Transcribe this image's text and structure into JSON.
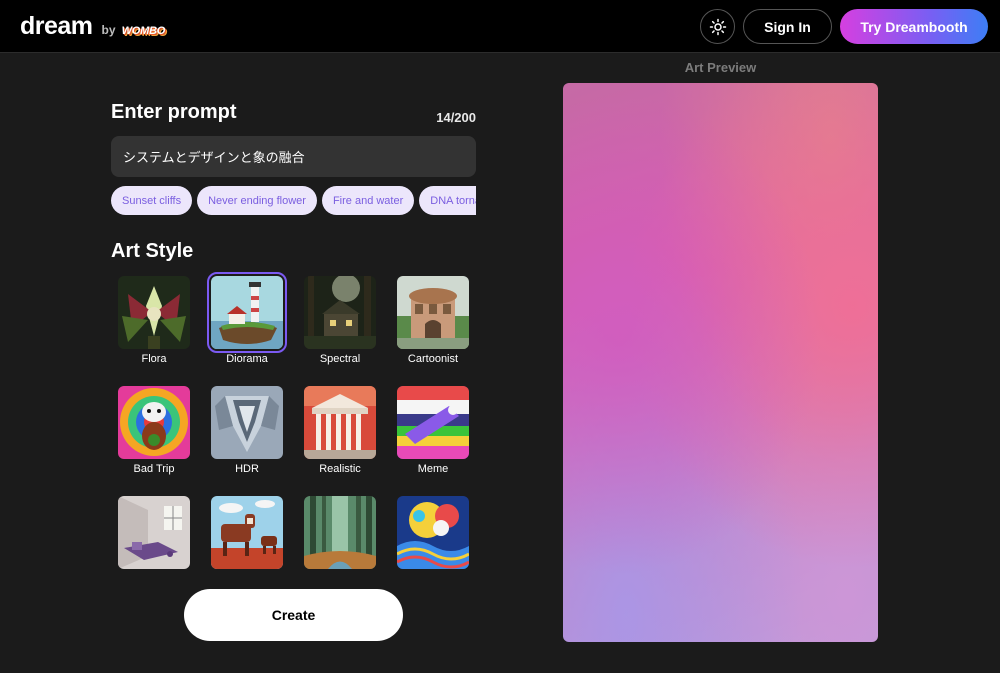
{
  "header": {
    "logo_main": "dream",
    "logo_by": "by",
    "logo_brand": "WOMBO",
    "theme_icon": "sun-icon",
    "signin_label": "Sign In",
    "try_label": "Try Dreambooth"
  },
  "prompt": {
    "title": "Enter prompt",
    "count": "14/200",
    "value": "システムとデザインと象の融合",
    "suggestions": [
      "Sunset cliffs",
      "Never ending flower",
      "Fire and water",
      "DNA tornado"
    ]
  },
  "art_style": {
    "title": "Art Style",
    "selected": "Diorama",
    "styles": [
      {
        "label": "Flora"
      },
      {
        "label": "Diorama"
      },
      {
        "label": "Spectral"
      },
      {
        "label": "Cartoonist"
      },
      {
        "label": "Bad Trip"
      },
      {
        "label": "HDR"
      },
      {
        "label": "Realistic"
      },
      {
        "label": "Meme"
      },
      {
        "label": ""
      },
      {
        "label": ""
      },
      {
        "label": ""
      },
      {
        "label": ""
      }
    ]
  },
  "create_label": "Create",
  "preview": {
    "label": "Art Preview"
  },
  "colors": {
    "accent_purple": "#7b5af2",
    "chip_bg": "#ece6fb",
    "chip_text": "#7a5ee0",
    "background": "#1b1b1b"
  }
}
